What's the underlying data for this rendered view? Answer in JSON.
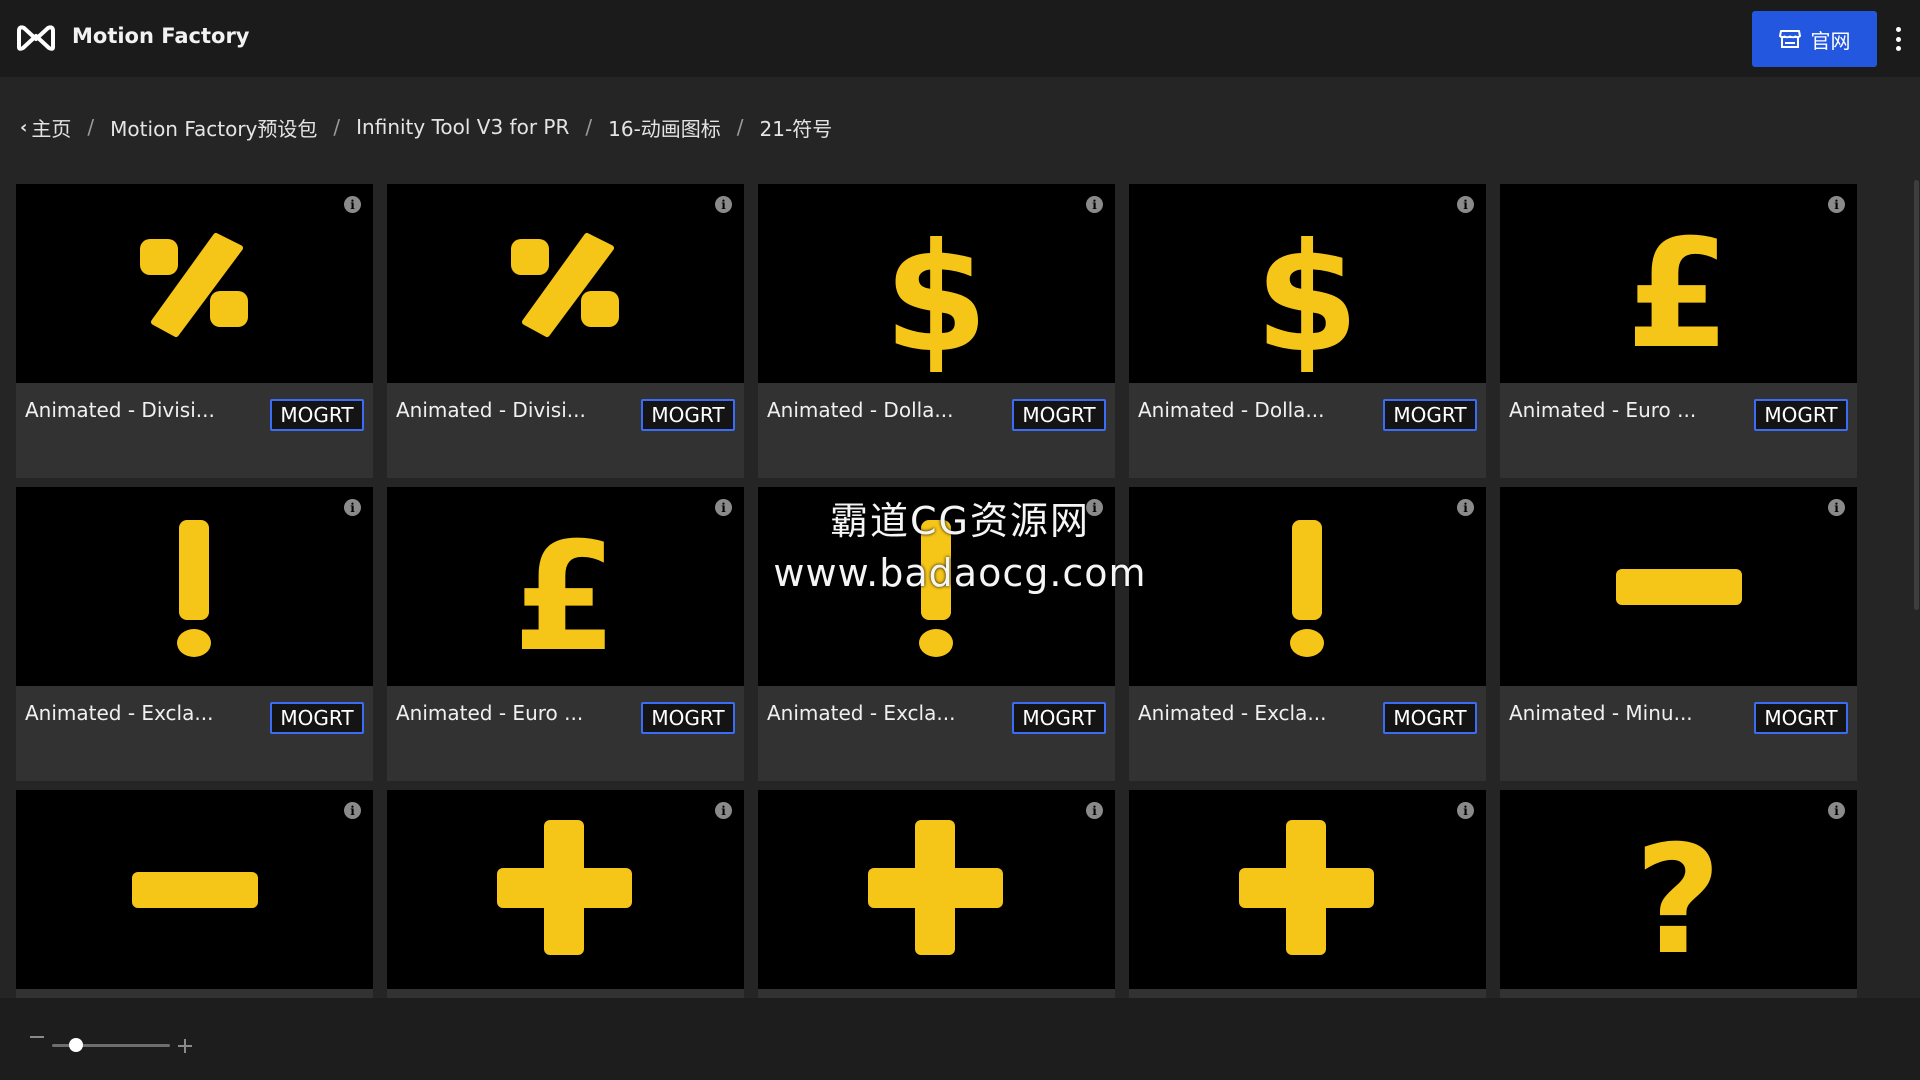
{
  "app": {
    "title": "Motion Factory",
    "site_button_label": "官网",
    "accent": "#2357e0",
    "icon_color": "#f5c518"
  },
  "breadcrumb": [
    "主页",
    "Motion Factory预设包",
    "Infinity Tool V3 for PR",
    "16-动画图标",
    "21-符号"
  ],
  "breadcrumb_separator": "/",
  "cards": [
    {
      "title": "Animated - Divisi...",
      "badge": "MOGRT",
      "icon": "percent-icon"
    },
    {
      "title": "Animated - Divisi...",
      "badge": "MOGRT",
      "icon": "percent-icon"
    },
    {
      "title": "Animated - Dolla...",
      "badge": "MOGRT",
      "icon": "dollar-icon"
    },
    {
      "title": "Animated - Dolla...",
      "badge": "MOGRT",
      "icon": "dollar-icon"
    },
    {
      "title": "Animated - Euro ...",
      "badge": "MOGRT",
      "icon": "pound-icon"
    },
    {
      "title": "Animated - Excla...",
      "badge": "MOGRT",
      "icon": "exclamation-icon"
    },
    {
      "title": "Animated - Euro ...",
      "badge": "MOGRT",
      "icon": "pound-icon"
    },
    {
      "title": "Animated - Excla...",
      "badge": "MOGRT",
      "icon": "exclamation-icon"
    },
    {
      "title": "Animated - Excla...",
      "badge": "MOGRT",
      "icon": "exclamation-icon"
    },
    {
      "title": "Animated - Minu...",
      "badge": "MOGRT",
      "icon": "minus-icon"
    },
    {
      "title": "",
      "badge": "",
      "icon": "minus-icon"
    },
    {
      "title": "",
      "badge": "",
      "icon": "plus-icon"
    },
    {
      "title": "",
      "badge": "",
      "icon": "plus-icon"
    },
    {
      "title": "",
      "badge": "",
      "icon": "plus-icon"
    },
    {
      "title": "",
      "badge": "",
      "icon": "question-icon"
    }
  ],
  "watermark": {
    "line1": "霸道CG资源网",
    "line2": "www.badaocg.com"
  },
  "zoom": {
    "level": 0.2
  }
}
